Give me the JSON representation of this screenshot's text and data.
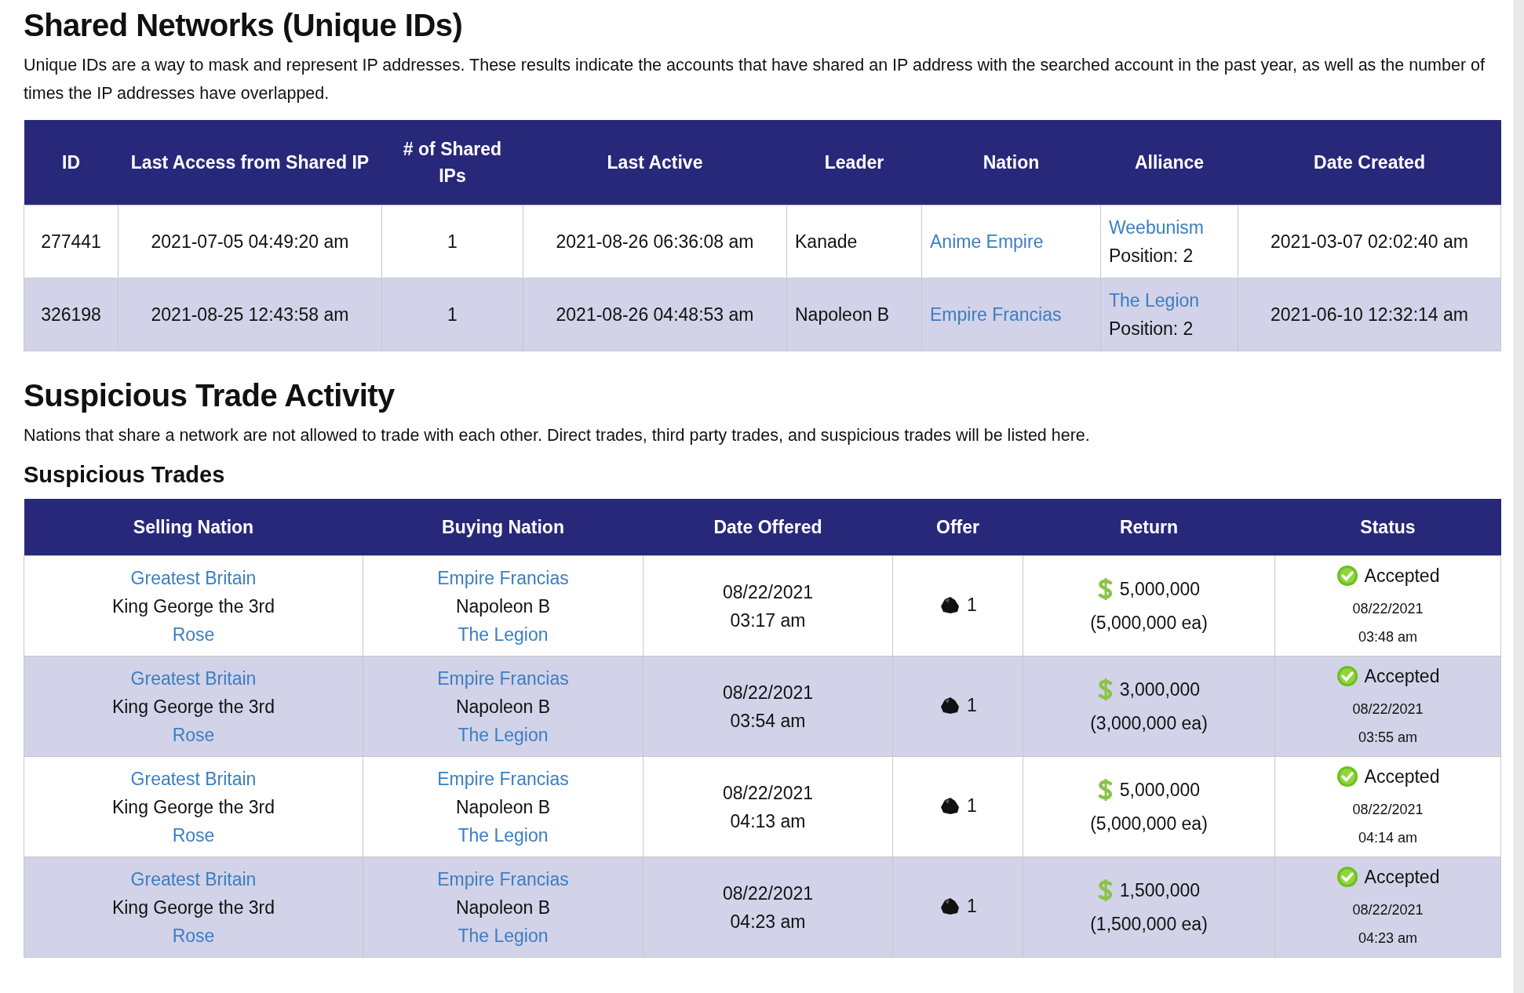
{
  "shared_networks": {
    "title": "Shared Networks (Unique IDs)",
    "description": "Unique IDs are a way to mask and represent IP addresses. These results indicate the accounts that have shared an IP address with the searched account in the past year, as well as the number of times the IP addresses have overlapped.",
    "columns": [
      "ID",
      "Last Access from Shared IP",
      "# of Shared IPs",
      "Last Active",
      "Leader",
      "Nation",
      "Alliance",
      "Date Created"
    ],
    "rows": [
      {
        "id": "277441",
        "last_access": "2021-07-05 04:49:20 am",
        "shared_ips": "1",
        "last_active": "2021-08-26 06:36:08 am",
        "leader": "Kanade",
        "nation": "Anime Empire",
        "alliance": "Weebunism",
        "position": "Position: 2",
        "date_created": "2021-03-07 02:02:40 am"
      },
      {
        "id": "326198",
        "last_access": "2021-08-25 12:43:58 am",
        "shared_ips": "1",
        "last_active": "2021-08-26 04:48:53 am",
        "leader": "Napoleon B",
        "nation": "Empire Francias",
        "alliance": "The Legion",
        "position": "Position: 2",
        "date_created": "2021-06-10 12:32:14 am"
      }
    ]
  },
  "suspicious": {
    "title": "Suspicious Trade Activity",
    "description": "Nations that share a network are not allowed to trade with each other. Direct trades, third party trades, and suspicious trades will be listed here.",
    "subtitle": "Suspicious Trades",
    "columns": [
      "Selling Nation",
      "Buying Nation",
      "Date Offered",
      "Offer",
      "Return",
      "Status"
    ],
    "rows": [
      {
        "seller_nation": "Greatest Britain",
        "seller_leader": "King George the 3rd",
        "seller_alliance": "Rose",
        "buyer_nation": "Empire Francias",
        "buyer_leader": "Napoleon B",
        "buyer_alliance": "The Legion",
        "date": "08/22/2021",
        "time": "03:17 am",
        "offer": "1",
        "return": "5,000,000",
        "return_each": "(5,000,000 ea)",
        "status": "Accepted",
        "status_date": "08/22/2021",
        "status_time": "03:48 am"
      },
      {
        "seller_nation": "Greatest Britain",
        "seller_leader": "King George the 3rd",
        "seller_alliance": "Rose",
        "buyer_nation": "Empire Francias",
        "buyer_leader": "Napoleon B",
        "buyer_alliance": "The Legion",
        "date": "08/22/2021",
        "time": "03:54 am",
        "offer": "1",
        "return": "3,000,000",
        "return_each": "(3,000,000 ea)",
        "status": "Accepted",
        "status_date": "08/22/2021",
        "status_time": "03:55 am"
      },
      {
        "seller_nation": "Greatest Britain",
        "seller_leader": "King George the 3rd",
        "seller_alliance": "Rose",
        "buyer_nation": "Empire Francias",
        "buyer_leader": "Napoleon B",
        "buyer_alliance": "The Legion",
        "date": "08/22/2021",
        "time": "04:13 am",
        "offer": "1",
        "return": "5,000,000",
        "return_each": "(5,000,000 ea)",
        "status": "Accepted",
        "status_date": "08/22/2021",
        "status_time": "04:14 am"
      },
      {
        "seller_nation": "Greatest Britain",
        "seller_leader": "King George the 3rd",
        "seller_alliance": "Rose",
        "buyer_nation": "Empire Francias",
        "buyer_leader": "Napoleon B",
        "buyer_alliance": "The Legion",
        "date": "08/22/2021",
        "time": "04:23 am",
        "offer": "1",
        "return": "1,500,000",
        "return_each": "(1,500,000 ea)",
        "status": "Accepted",
        "status_date": "08/22/2021",
        "status_time": "04:23 am"
      }
    ]
  }
}
